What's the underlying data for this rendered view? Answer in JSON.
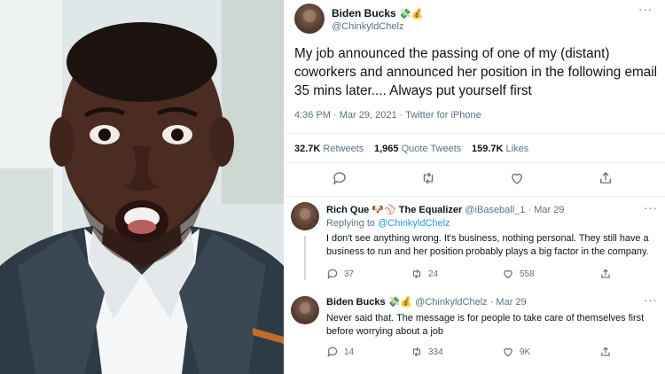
{
  "main_tweet": {
    "name": "Biden Bucks",
    "name_emoji": "💸💰",
    "handle": "@ChinkyldChelz",
    "text": "My job announced the passing of one of my (distant) coworkers and announced her position in the following email 35 mins later.... Always put yourself first",
    "meta": "4:36 PM · Mar 29, 2021 · Twitter for iPhone",
    "retweets_count": "32.7K",
    "retweets_label": "Retweets",
    "quote_count": "1,965",
    "quote_label": "Quote Tweets",
    "likes_count": "159.7K",
    "likes_label": "Likes"
  },
  "replies": [
    {
      "name": "Rich Que 🐶⚾ The Equalizer",
      "handle_date": "@iBaseball_1 · Mar 29",
      "replying_prefix": "Replying to",
      "replying_to": "@ChinkyldChelz",
      "text": "I don't see anything wrong. It's business, nothing personal. They still have a business to run and her position probably plays a big factor in the company.",
      "reply_count": "37",
      "retweet_count": "24",
      "like_count": "558"
    },
    {
      "name": "Biden Bucks",
      "name_emoji": "💸💰",
      "handle_date": "@ChinkyldChelz · Mar 29",
      "text": "Never said that. The message is for people to take care of themselves first before worrying about a job",
      "reply_count": "14",
      "retweet_count": "334",
      "like_count": "9K"
    }
  ],
  "colors": {
    "accent": "#1d9bf0",
    "muted": "#5b7083",
    "text": "#0f1419",
    "border": "#e6ecf0"
  },
  "icons": [
    "reply-icon",
    "retweet-icon",
    "like-icon",
    "share-icon",
    "more-icon"
  ]
}
